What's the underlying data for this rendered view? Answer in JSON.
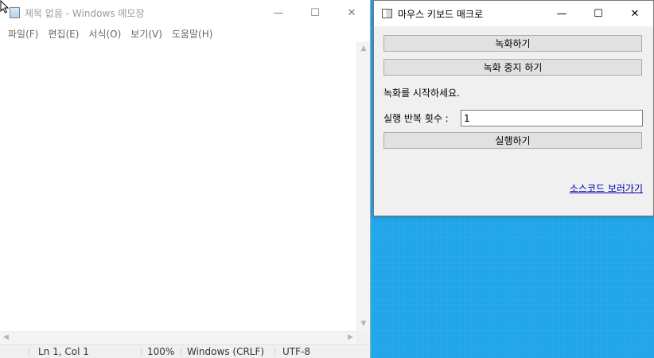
{
  "notepad": {
    "title": "제목 없음 - Windows 메모장",
    "menu": [
      "파일(F)",
      "편집(E)",
      "서식(O)",
      "보기(V)",
      "도움말(H)"
    ],
    "status": {
      "position": "Ln 1, Col 1",
      "zoom": "100%",
      "line_ending": "Windows (CRLF)",
      "encoding": "UTF-8"
    },
    "window_buttons": {
      "minimize": "—",
      "maximize": "☐",
      "close": "✕"
    }
  },
  "macro": {
    "title": "마우스 키보드 매크로",
    "record_button": "녹화하기",
    "stop_record_button": "녹화 중지 하기",
    "status_text": "녹화를 시작하세요.",
    "repeat_label": "실행 반복 횟수 :",
    "repeat_value": "1",
    "run_button": "실행하기",
    "source_link": "소스코드 보러가기",
    "window_buttons": {
      "minimize": "—",
      "maximize": "☐",
      "close": "✕"
    }
  },
  "colors": {
    "desktop": "#1aa3e8",
    "link": "#0000a8"
  }
}
